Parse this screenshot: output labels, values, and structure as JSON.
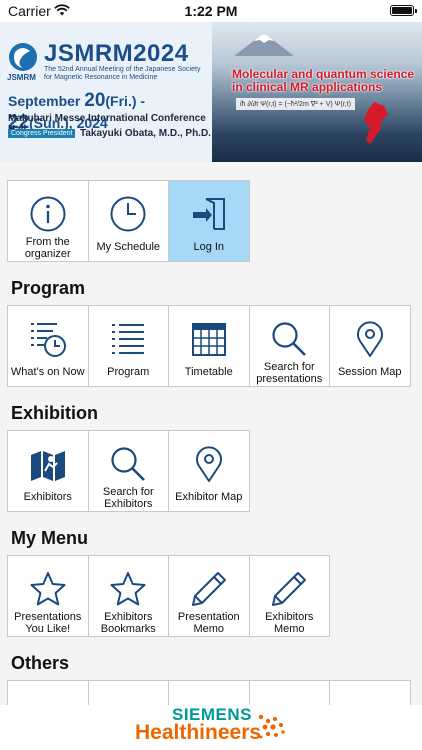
{
  "status_bar": {
    "carrier": "Carrier",
    "time": "1:22 PM"
  },
  "banner": {
    "logo_text": "JSMRM",
    "title": "JSMRM2024",
    "subtitle": "The 52nd Annual Meeting of the Japanese Society for Magnetic Resonance in Medicine",
    "dates_prefix": "September ",
    "date_start": "20",
    "date_start_day": "(Fri.)",
    "date_sep": " - ",
    "date_end": "22",
    "date_end_day": "(Sun.), 2024",
    "venue": "Makuhari Messe International Conference Hall",
    "president_badge": "Congress President",
    "president_name": "Takayuki Obata, M.D., Ph.D.",
    "theme": "Molecular and quantum science in clinical MR applications",
    "formula": "iħ ∂/∂t Ψ(r,t) = (−ħ²/2m ∇² + V) Ψ(r,t)"
  },
  "top_tiles": [
    {
      "label": "From the organizer",
      "icon": "info-icon"
    },
    {
      "label": "My Schedule",
      "icon": "clock-icon"
    },
    {
      "label": "Log In",
      "icon": "login-icon",
      "active": true
    }
  ],
  "sections": {
    "program": {
      "title": "Program",
      "tiles": [
        {
          "label": "What's on Now",
          "icon": "list-clock-icon"
        },
        {
          "label": "Program",
          "icon": "list-icon"
        },
        {
          "label": "Timetable",
          "icon": "calendar-grid-icon"
        },
        {
          "label": "Search for presentations",
          "icon": "search-icon"
        },
        {
          "label": "Session Map",
          "icon": "map-pin-icon"
        }
      ]
    },
    "exhibition": {
      "title": "Exhibition",
      "tiles": [
        {
          "label": "Exhibitors",
          "icon": "exhibitor-map-icon"
        },
        {
          "label": "Search for Exhibitors",
          "icon": "search-icon"
        },
        {
          "label": "Exhibitor Map",
          "icon": "map-pin-icon"
        }
      ]
    },
    "my_menu": {
      "title": "My Menu",
      "tiles": [
        {
          "label": "Presentations You Like!",
          "icon": "star-icon"
        },
        {
          "label": "Exhibitors Bookmarks",
          "icon": "star-icon"
        },
        {
          "label": "Presentation Memo",
          "icon": "pencil-icon"
        },
        {
          "label": "Exhibitors Memo",
          "icon": "pencil-icon"
        }
      ]
    },
    "others": {
      "title": "Others"
    }
  },
  "footer": {
    "siemens": "SIEMENS",
    "healthineers": "Healthineers"
  },
  "colors": {
    "icon_blue": "#1a4a7e",
    "active_tile": "#a6d8f8",
    "brand_teal": "#009999",
    "brand_orange": "#ec6602"
  }
}
